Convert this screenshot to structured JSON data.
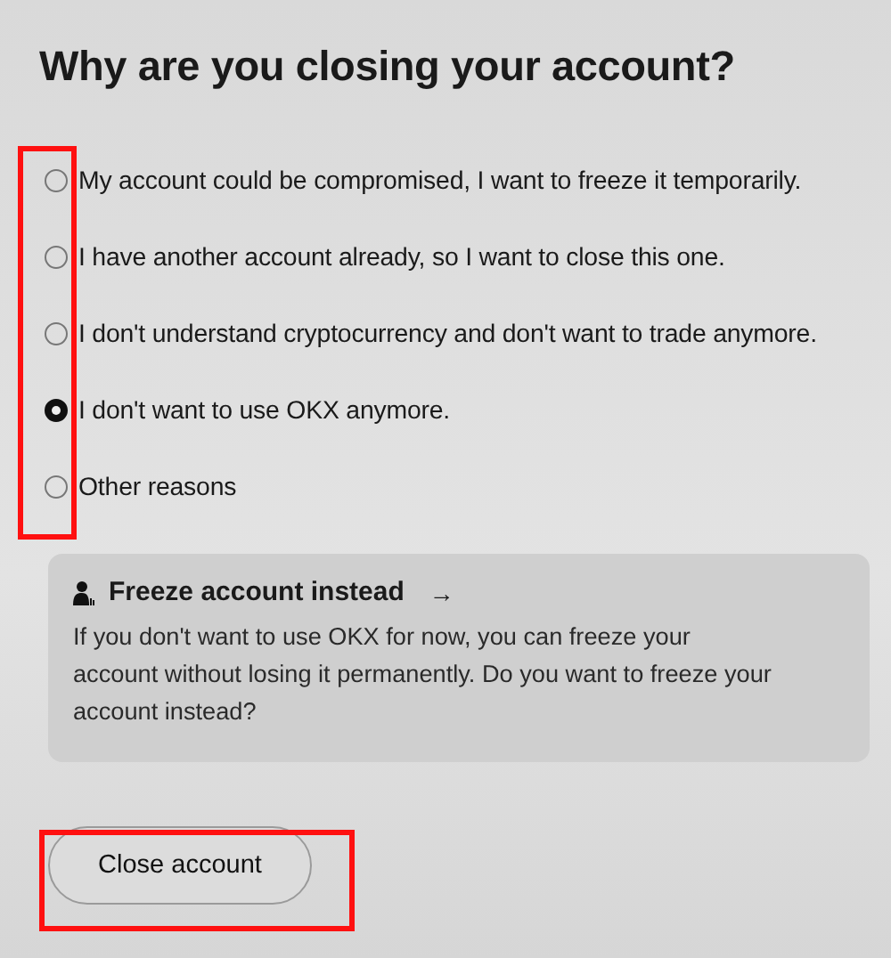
{
  "title": "Why are you closing your account?",
  "reasons": [
    {
      "label": "My account could be compromised, I want to freeze it temporarily.",
      "selected": false
    },
    {
      "label": "I have another account already, so I want to close this one.",
      "selected": false
    },
    {
      "label": "I don't understand cryptocurrency and don't want to trade anymore.",
      "selected": false
    },
    {
      "label": "I don't want to use OKX anymore.",
      "selected": true
    },
    {
      "label": "Other reasons",
      "selected": false
    }
  ],
  "freeze_card": {
    "title": "Freeze account instead",
    "arrow": "→",
    "body": "If you don't want to use OKX for now, you can freeze your account without losing it permanently. Do you want to freeze your account instead?"
  },
  "close_button": "Close account"
}
